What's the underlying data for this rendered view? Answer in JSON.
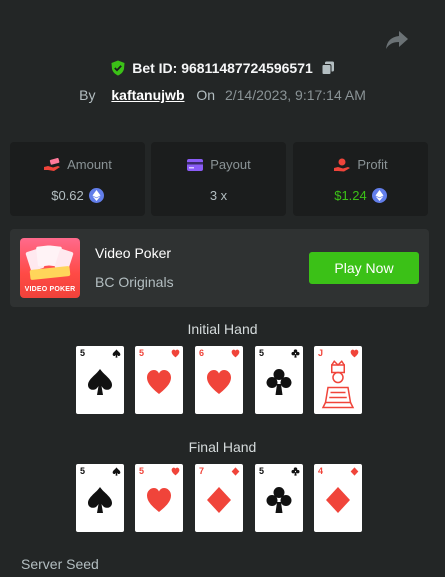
{
  "header": {
    "bet_id_label": "Bet ID: 96811487724596571",
    "by_label": "By",
    "username": "kaftanujwb",
    "on_label": "On",
    "date": "2/14/2023, 9:17:14 AM"
  },
  "stats": [
    {
      "label": "Amount",
      "value": "$0.62",
      "icon": "money-hand-icon",
      "currency_icon": "ethereum-icon"
    },
    {
      "label": "Payout",
      "value": "3 x",
      "icon": "card-payout-icon"
    },
    {
      "label": "Profit",
      "value": "$1.24",
      "icon": "profit-hand-icon",
      "currency_icon": "ethereum-icon"
    }
  ],
  "game": {
    "thumbnail_text": "VIDEO POKER",
    "title": "Video Poker",
    "provider": "BC Originals",
    "play_label": "Play Now"
  },
  "initial_hand": {
    "title": "Initial Hand",
    "cards": [
      {
        "rank": "5",
        "suit": "spade"
      },
      {
        "rank": "5",
        "suit": "heart"
      },
      {
        "rank": "6",
        "suit": "heart"
      },
      {
        "rank": "5",
        "suit": "club"
      },
      {
        "rank": "J",
        "suit": "heart",
        "face": true
      }
    ]
  },
  "final_hand": {
    "title": "Final Hand",
    "cards": [
      {
        "rank": "5",
        "suit": "spade"
      },
      {
        "rank": "5",
        "suit": "heart"
      },
      {
        "rank": "7",
        "suit": "diamond"
      },
      {
        "rank": "5",
        "suit": "club"
      },
      {
        "rank": "4",
        "suit": "diamond"
      }
    ]
  },
  "server_seed_label": "Server Seed",
  "colors": {
    "background": "#232626",
    "panel": "#1b1d1d",
    "game_panel": "#2f3232",
    "accent_green": "#3bc117",
    "suit_red": "#f0443a",
    "eth_blue": "#627eea"
  }
}
